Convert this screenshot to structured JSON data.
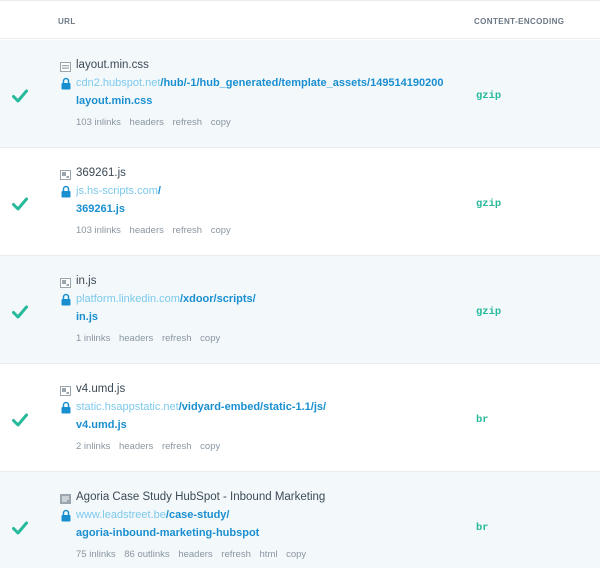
{
  "header": {
    "url_label": "URL",
    "encoding_label": "CONTENT-ENCODING"
  },
  "colors": {
    "check": "#26b99a",
    "host_link": "#7cc9ec",
    "path_link": "#1a8fd0",
    "encoding": "#26b99a",
    "row_shade": "#f3f8fb"
  },
  "rows": [
    {
      "status_icon": "check-icon",
      "file_icon": "css-file-icon",
      "name": "layout.min.css",
      "host": "cdn2.hubspot.net",
      "path": "/hub/-1/hub_generated/template_assets/149514190200",
      "path2": "layout.min.css",
      "actions": [
        "103 inlinks",
        "headers",
        "refresh",
        "copy"
      ],
      "encoding": "gzip"
    },
    {
      "status_icon": "check-icon",
      "file_icon": "js-file-icon",
      "name": "369261.js",
      "host": "js.hs-scripts.com",
      "path": "/",
      "path2": "369261.js",
      "actions": [
        "103 inlinks",
        "headers",
        "refresh",
        "copy"
      ],
      "encoding": "gzip"
    },
    {
      "status_icon": "check-icon",
      "file_icon": "js-file-icon",
      "name": "in.js",
      "host": "platform.linkedin.com",
      "path": "/xdoor/scripts/",
      "path2": "in.js",
      "actions": [
        "1 inlinks",
        "headers",
        "refresh",
        "copy"
      ],
      "encoding": "gzip"
    },
    {
      "status_icon": "check-icon",
      "file_icon": "js-file-icon",
      "name": "v4.umd.js",
      "host": "static.hsappstatic.net",
      "path": "/vidyard-embed/static-1.1/js/",
      "path2": "v4.umd.js",
      "actions": [
        "2 inlinks",
        "headers",
        "refresh",
        "copy"
      ],
      "encoding": "br"
    },
    {
      "status_icon": "check-icon",
      "file_icon": "html-file-icon",
      "name": "Agoria Case Study HubSpot - Inbound Marketing",
      "host": "www.leadstreet.be",
      "path": "/case-study/",
      "path2": "agoria-inbound-marketing-hubspot",
      "actions": [
        "75 inlinks",
        "86 outlinks",
        "headers",
        "refresh",
        "html",
        "copy"
      ],
      "encoding": "br"
    }
  ]
}
